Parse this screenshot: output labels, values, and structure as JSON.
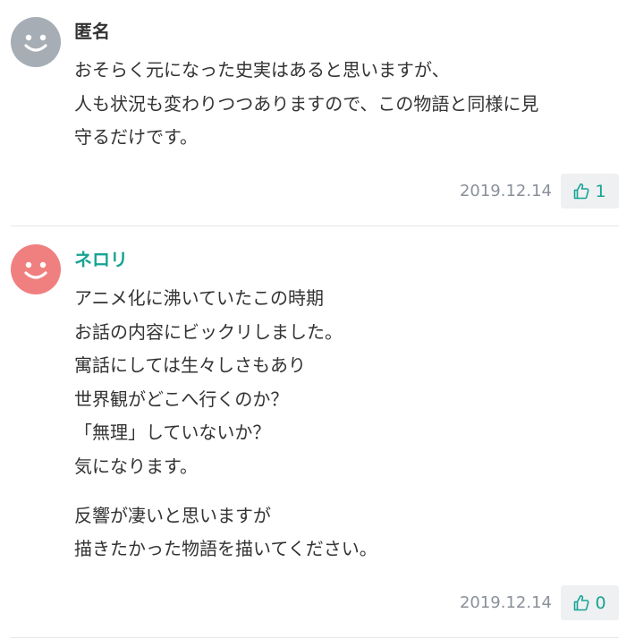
{
  "colors": {
    "accent": "#17a394",
    "avatar_anonymous": "#a6adb5",
    "avatar_user": "#f08080",
    "date_text": "#8a9099",
    "divider": "#e4e6e8",
    "like_bg": "#eef0f2"
  },
  "comments": [
    {
      "author": "匿名",
      "lines": [
        "おそらく元になった史実はあると思いますが、",
        "人も状況も変わりつつありますので、この物語と同様に見",
        "守るだけです。"
      ],
      "date": "2019.12.14",
      "likes": "1",
      "like_icon": "thumbs-up-icon"
    },
    {
      "author": "ネロリ",
      "paragraph1": [
        "アニメ化に沸いていたこの時期",
        "お話の内容にビックリしました。",
        "寓話にしては生々しさもあり",
        "世界観がどこへ行くのか？",
        "「無理」していないか？",
        "気になります。"
      ],
      "paragraph2": [
        "反響が凄いと思いますが",
        "描きたかった物語を描いてください。"
      ],
      "date": "2019.12.14",
      "likes": "0",
      "like_icon": "thumbs-up-icon"
    }
  ]
}
